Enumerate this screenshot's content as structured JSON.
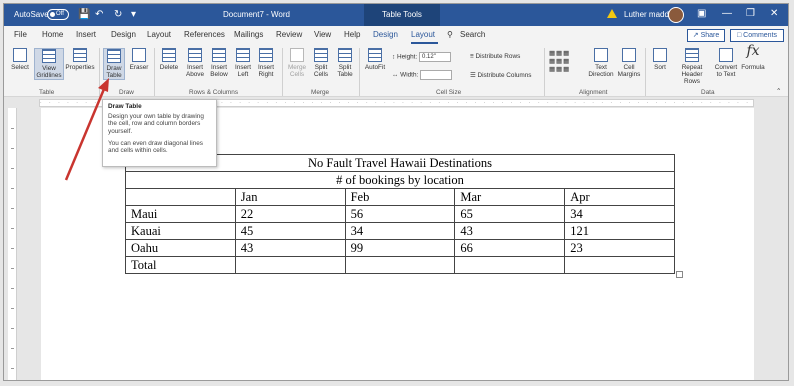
{
  "titlebar": {
    "autosave_label": "AutoSave",
    "autosave_state": "Off",
    "document_name": "Document7 - Word",
    "contextual_tab": "Table Tools",
    "user_name": "Luther maddy",
    "accent_color": "#2b579a"
  },
  "tabs": [
    "File",
    "Home",
    "Insert",
    "Design",
    "Layout",
    "References",
    "Mailings",
    "Review",
    "View",
    "Help",
    "Design",
    "Layout"
  ],
  "search_label": "Search",
  "share_label": "Share",
  "comments_label": "Comments",
  "ribbon": {
    "table_group": {
      "label": "Table",
      "select": "Select",
      "view_gridlines": "View Gridlines",
      "properties": "Properties"
    },
    "draw_group": {
      "label": "Draw",
      "draw_table": "Draw Table",
      "eraser": "Eraser"
    },
    "rows_columns_group": {
      "label": "Rows & Columns",
      "delete": "Delete",
      "insert_above": "Insert Above",
      "insert_below": "Insert Below",
      "insert_left": "Insert Left",
      "insert_right": "Insert Right"
    },
    "merge_group": {
      "label": "Merge",
      "merge_cells": "Merge Cells",
      "split_cells": "Split Cells",
      "split_table": "Split Table"
    },
    "cell_size_group": {
      "label": "Cell Size",
      "autofit": "AutoFit",
      "height_label": "Height:",
      "height_value": "0.12\"",
      "width_label": "Width:",
      "width_value": "",
      "distribute_rows": "Distribute Rows",
      "distribute_columns": "Distribute Columns"
    },
    "alignment_group": {
      "label": "Alignment",
      "text_direction": "Text Direction",
      "cell_margins": "Cell Margins"
    },
    "data_group": {
      "label": "Data",
      "sort": "Sort",
      "repeat_header_rows": "Repeat Header Rows",
      "convert_to_text": "Convert to Text",
      "formula": "Formula"
    }
  },
  "tooltip": {
    "title": "Draw Table",
    "body": "Design your own table by drawing the cell, row and column borders yourself.",
    "extra": "You can even draw diagonal lines and cells within cells."
  },
  "table": {
    "title": "No Fault Travel Hawaii Destinations",
    "subtitle": "# of bookings by location",
    "headers": [
      "",
      "Jan",
      "Feb",
      "Mar",
      "Apr"
    ],
    "rows": [
      [
        "Maui",
        "22",
        "56",
        "65",
        "34"
      ],
      [
        "Kauai",
        "45",
        "34",
        "43",
        "121"
      ],
      [
        "Oahu",
        "43",
        "99",
        "66",
        "23"
      ],
      [
        "Total",
        "",
        "",
        "",
        ""
      ]
    ]
  }
}
